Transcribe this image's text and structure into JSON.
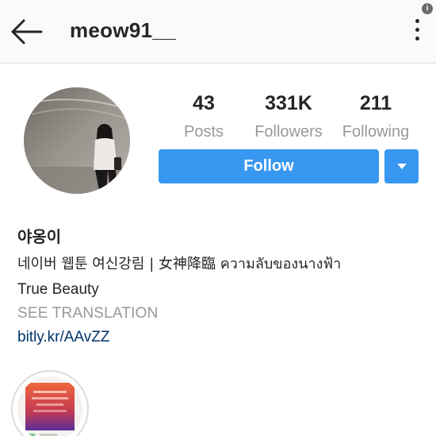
{
  "header": {
    "username": "meow91__",
    "info_badge": "i",
    "icons": {
      "back": "back-arrow-icon",
      "more": "more-vertical-icon"
    }
  },
  "profile": {
    "stats": {
      "posts": {
        "value": "43",
        "label": "Posts"
      },
      "followers": {
        "value": "331K",
        "label": "Followers"
      },
      "following": {
        "value": "211",
        "label": "Following"
      }
    },
    "follow_button": "Follow",
    "dropdown_icon": "caret-down-icon"
  },
  "bio": {
    "name": "야옹이",
    "line1": "네이버 웹툰 여신강림 |  女神降臨 ความลับของนางฟ้า",
    "line2": "True Beauty",
    "see_translation": "SEE TRANSLATION",
    "link": "bitly.kr/AAvZZ"
  },
  "colors": {
    "accent": "#3897f0",
    "muted": "#999999",
    "link": "#003569",
    "text": "#262626"
  }
}
